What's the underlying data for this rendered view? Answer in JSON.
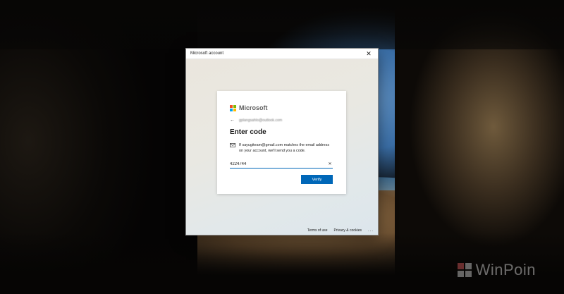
{
  "window": {
    "title": "Microsoft account",
    "close_glyph": "✕"
  },
  "card": {
    "brand": "Microsoft",
    "back_glyph": "←",
    "identity_email": "gplangsahlo@outlook.com",
    "heading": "Enter code",
    "notice": "If sayugiteam@gmail.com matches the email address on your account, we'll send you a code.",
    "code_value": "4224744",
    "clear_glyph": "✕",
    "verify_label": "Verify"
  },
  "footer": {
    "terms": "Terms of use",
    "privacy": "Privacy & cookies",
    "more": "..."
  },
  "watermark": {
    "text": "WinPoin"
  },
  "colors": {
    "accent": "#0067b8",
    "ms_red": "#f25022",
    "ms_green": "#7fba00",
    "ms_blue": "#00a4ef",
    "ms_yellow": "#ffb900"
  }
}
